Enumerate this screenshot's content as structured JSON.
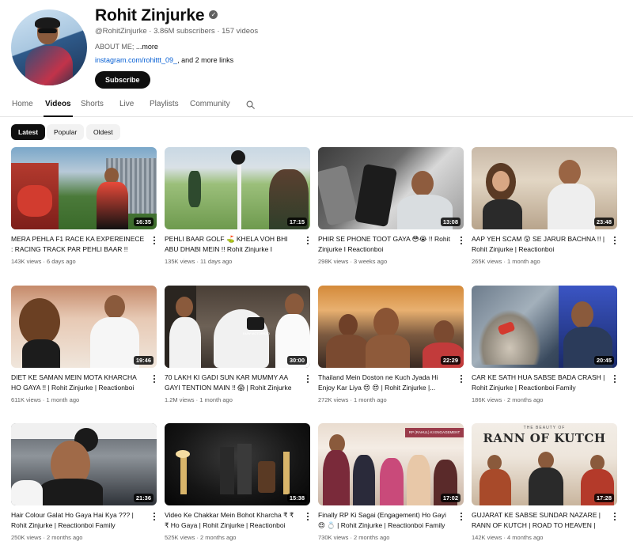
{
  "channel": {
    "name": "Rohit Zinjurke",
    "handle": "@RohitZinjurke",
    "subscribers": "3.86M subscribers",
    "videos_count": "157 videos",
    "about_label": "ABOUT ME; ",
    "about_more": "...more",
    "link": "instagram.com/rohittt_09_",
    "link_more": ", and 2 more links",
    "subscribe_label": "Subscribe",
    "meta_sep": " · "
  },
  "tabs": [
    {
      "label": "Home",
      "active": false
    },
    {
      "label": "Videos",
      "active": true
    },
    {
      "label": "Shorts",
      "active": false
    },
    {
      "label": "Live",
      "active": false
    },
    {
      "label": "Playlists",
      "active": false
    },
    {
      "label": "Community",
      "active": false
    }
  ],
  "filters": [
    {
      "label": "Latest",
      "active": true
    },
    {
      "label": "Popular",
      "active": false
    },
    {
      "label": "Oldest",
      "active": false
    }
  ],
  "icons": {
    "verified": "verified-check-icon",
    "search": "search-icon",
    "more": "more-vert-icon"
  },
  "colors": {
    "accent": "#0f0f0f",
    "link": "#065fd4",
    "secondary_text": "#606060"
  },
  "videos": [
    {
      "title": "MERA PEHLA F1 RACE KA EXPEREINECE : RACING TRACK PAR PEHLI BAAR !! Rohit...",
      "duration": "16:35",
      "views": "143K views",
      "age": "6 days ago"
    },
    {
      "title": "PEHLI BAAR GOLF ⛳ KHELA VOH BHI ABU DHABI MEIN !! Rohit Zinjurke I Reactionboi",
      "duration": "17:15",
      "views": "135K views",
      "age": "11 days ago"
    },
    {
      "title": "PHIR SE PHONE TOOT GAYA 😳😭 !! Rohit Zinjurke I Reactionboi",
      "duration": "13:08",
      "views": "298K views",
      "age": "3 weeks ago"
    },
    {
      "title": "AAP YEH SCAM 😲 SE JARUR BACHNA !! | Rohit Zinjurke | Reactionboi",
      "duration": "23:48",
      "views": "265K views",
      "age": "1 month ago"
    },
    {
      "title": "DIET KE SAMAN MEIN MOTA KHARCHA HO GAYA !! | Rohit Zinjurke | Reactionboi",
      "duration": "19:46",
      "views": "611K views",
      "age": "1 month ago"
    },
    {
      "title": "70 LAKH KI GADI SUN KAR MUMMY AA GAYI TENTION MAIN !! 😱 | Rohit Zinjurke I...",
      "duration": "30:00",
      "views": "1.2M views",
      "age": "1 month ago"
    },
    {
      "title": "Thailand Mein Doston ne Kuch Jyada Hi Enjoy Kar Liya 😍 😍 | Rohit Zinjurke |...",
      "duration": "22:29",
      "views": "272K views",
      "age": "1 month ago"
    },
    {
      "title": "CAR KE SATH HUA SABSE BADA CRASH | Rohit Zinjurke | Reactionboi Family",
      "duration": "20:45",
      "views": "186K views",
      "age": "2 months ago"
    },
    {
      "title": "Hair Colour Galat Ho Gaya Hai Kya ??? | Rohit Zinjurke | Reactionboi Family",
      "duration": "21:36",
      "views": "250K views",
      "age": "2 months ago"
    },
    {
      "title": "Video Ke Chakkar Mein Bohot Kharcha ₹ ₹ ₹ Ho Gaya | Rohit Zinjurke | Reactionboi Family",
      "duration": "15:38",
      "views": "525K views",
      "age": "2 months ago"
    },
    {
      "title": "Finally RP Ki Sagai (Engagement) Ho Gayi 😍 💍 | Rohit Zinjurke | Reactionboi Family",
      "duration": "17:02",
      "views": "730K views",
      "age": "2 months ago"
    },
    {
      "title": "GUJARAT KE SABSE SUNDAR NAZARE | RANN OF KUTCH | ROAD TO HEAVEN | Roh...",
      "duration": "17:28",
      "views": "142K views",
      "age": "4 months ago"
    }
  ],
  "thumb_texts": {
    "bmw": "BMW MOTORRAD",
    "engagement": "RP (RAHUL) KI ENGAGEMENT",
    "kutch_small": "THE BEAUTY OF",
    "kutch_big": "RANN OF KUTCH"
  }
}
